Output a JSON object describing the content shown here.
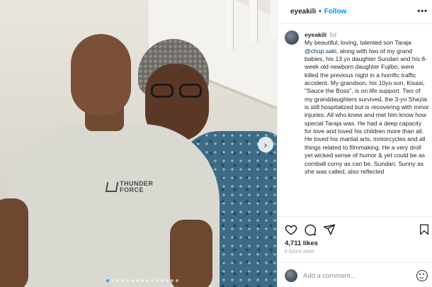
{
  "post": {
    "username": "eyeakili",
    "separator": "•",
    "follow_label": "Follow",
    "more_icon": "more-options-icon",
    "carousel_next_icon": "chevron-right-icon",
    "shirt_logo_text": "THUNDER FORCE"
  },
  "caption": {
    "username": "eyeakili",
    "time": "5d",
    "text_1": "My beautiful, loving, talented son Taraja ",
    "mention": "@chop.saki",
    "text_2": ", along with two of my grand babies, his 13 yo daughter Sundari and his 8-week old newborn daughter Fujibo, were killed the previous night in a horrific traffic accident. My grandson, his 10yo son, Kisasi, \"Sauce the Boss\", is on life support. Two of my granddaughters survived, the 3-yo Shazia is still hospitalized but is recovering with minor injuries. All who knew and met him know how special Taraja was. He had a deep capacity for love and loved his children more than all. He loved his martial arts, motorcycles and all things related to filmmaking. He a very droll yet wicked sense of humor & yet could be as cornball corny as can be. Sundari, Sunny as she was called, also reflected"
  },
  "actions": {
    "like_icon": "heart-icon",
    "comment_icon": "comment-icon",
    "share_icon": "share-icon",
    "save_icon": "bookmark-icon"
  },
  "stats": {
    "likes": "4,711 likes",
    "timestamp": "5 DAYS AGO"
  },
  "comment_box": {
    "placeholder": "Add a comment...",
    "emoji_icon": "emoji-icon"
  },
  "colors": {
    "link": "#0095f6",
    "text": "#262626",
    "muted": "#8e8e8e",
    "active_dot": "#3897f0"
  }
}
